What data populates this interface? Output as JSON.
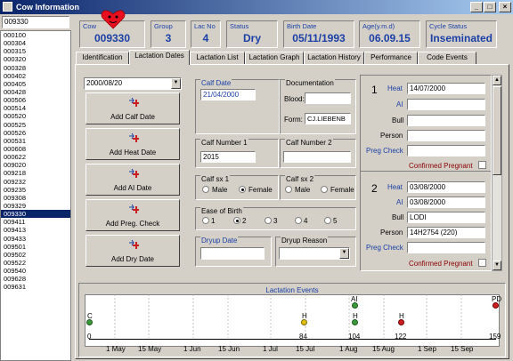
{
  "window": {
    "title": "Cow Information",
    "minimize": "_",
    "maximize": "□",
    "close": "×"
  },
  "search": {
    "value": "009330"
  },
  "cow_list": [
    "000100",
    "000304",
    "000315",
    "000320",
    "000328",
    "000402",
    "000405",
    "000428",
    "000506",
    "000514",
    "000520",
    "000525",
    "000526",
    "000531",
    "000608",
    "000622",
    "009020",
    "009218",
    "009232",
    "009235",
    "009308",
    "009329",
    "009330",
    "009411",
    "009413",
    "009433",
    "009501",
    "009502",
    "009522",
    "009540",
    "009628",
    "009631"
  ],
  "cow_list_selected": "009330",
  "header": {
    "cow": {
      "label": "Cow",
      "value": "009330"
    },
    "group": {
      "label": "Group",
      "value": "3"
    },
    "lac_no": {
      "label": "Lac No",
      "value": "4"
    },
    "status": {
      "label": "Status",
      "value": "Dry"
    },
    "birth_date": {
      "label": "Birth Date",
      "value": "05/11/1993"
    },
    "age": {
      "label": "Age(y.m.d)",
      "value": "06.09.15"
    },
    "cycle_status": {
      "label": "Cycle Status",
      "value": "Inseminated"
    }
  },
  "tabs": [
    "Identification",
    "Lactation Dates",
    "Lactation List",
    "Lactation Graph",
    "Lactation History",
    "Performance",
    "Code Events"
  ],
  "active_tab": "Lactation Dates",
  "date_select": {
    "value": "2000/08/20"
  },
  "action_buttons": [
    "Add Calf Date",
    "Add Heat Date",
    "Add AI Date",
    "Add Preg. Check",
    "Add Dry Date"
  ],
  "calf_date": {
    "label": "Calf Date",
    "value": "21/04/2000"
  },
  "documentation": {
    "label": "Documentation",
    "blood_label": "Blood:",
    "blood_value": "",
    "form_label": "Form:",
    "form_value": "CJ.LIEBENB"
  },
  "calf_number_1": {
    "label": "Calf Number 1",
    "value": "2015"
  },
  "calf_number_2": {
    "label": "Calf Number 2",
    "value": ""
  },
  "calf_sx_1": {
    "label": "Calf sx 1",
    "options": [
      "Male",
      "Female"
    ],
    "selected": "Female"
  },
  "calf_sx_2": {
    "label": "Calf sx 2",
    "options": [
      "Male",
      "Female"
    ],
    "selected": ""
  },
  "ease_of_birth": {
    "label": "Ease of Birth",
    "options": [
      "1",
      "2",
      "3",
      "4",
      "5"
    ],
    "selected": "2"
  },
  "dryup_date": {
    "label": "Dryup Date",
    "value": ""
  },
  "dryup_reason": {
    "label": "Dryup Reason",
    "value": ""
  },
  "cycles": [
    {
      "number": "1",
      "heat_label": "Heat",
      "heat": "14/07/2000",
      "ai_label": "AI",
      "ai": "",
      "bull_label": "Bull",
      "bull": "",
      "person_label": "Person",
      "person": "",
      "preg_label": "Preg Check",
      "preg": "",
      "confirmed_label": "Confirmed Pregnant",
      "confirmed": false
    },
    {
      "number": "2",
      "heat_label": "Heat",
      "heat": "03/08/2000",
      "ai_label": "AI",
      "ai": "03/08/2000",
      "bull_label": "Bull",
      "bull": "LODI",
      "person_label": "Person",
      "person": "14H2754 (220)",
      "preg_label": "Preg Check",
      "preg": "",
      "confirmed_label": "Confirmed Pregnant",
      "confirmed": false
    }
  ],
  "events": {
    "title": "Lactation Events",
    "months": [
      "1 May",
      "15 May",
      "1 Jun",
      "15 Jun",
      "1 Jul",
      "15 Jul",
      "1 Aug",
      "15 Aug",
      "1 Sep",
      "15 Sep"
    ],
    "markers": [
      {
        "label": "C",
        "color": "#3a9a3a",
        "day": "0"
      },
      {
        "label": "H",
        "color": "#e0c000",
        "day": "84"
      },
      {
        "label": "AI",
        "color": "#3a9a3a",
        "day": "104"
      },
      {
        "label": "H",
        "color": "#3a9a3a",
        "day": "104"
      },
      {
        "label": "H",
        "color": "#cc2020",
        "day": "122"
      },
      {
        "label": "PD",
        "color": "#cc2020",
        "day": "159"
      }
    ]
  },
  "colors": {
    "accent": "#1a3fa6",
    "selection": "#0a246a",
    "title_gradient_end": "#a6caf0"
  }
}
